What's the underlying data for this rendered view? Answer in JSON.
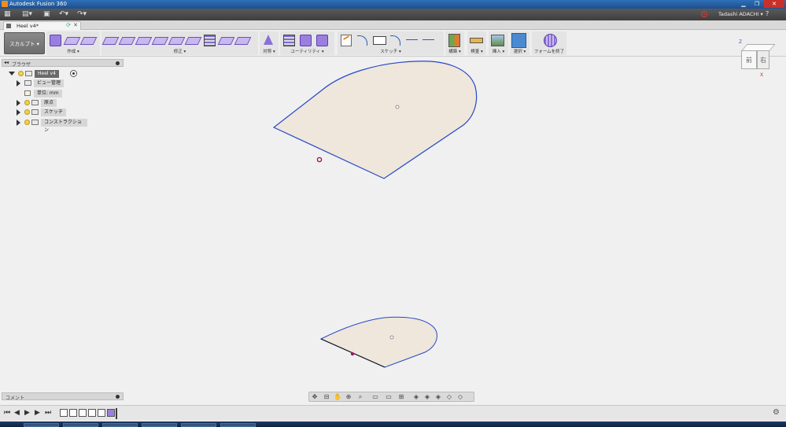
{
  "window": {
    "title": "Autodesk Fusion 360"
  },
  "quickbar": {
    "user": "Tadashi ADACHI ▾",
    "help": "?"
  },
  "tabs": [
    {
      "label": "Heel v4*"
    }
  ],
  "ribbon": {
    "workspace_label": "スカルプト ▾",
    "groups": [
      {
        "id": "create",
        "label": "作成 ▾"
      },
      {
        "id": "modify",
        "label": "修正 ▾"
      },
      {
        "id": "symmetry",
        "label": "対称 ▾"
      },
      {
        "id": "utility",
        "label": "ユーティリティ ▾"
      },
      {
        "id": "sketch",
        "label": "スケッチ ▾"
      },
      {
        "id": "construct",
        "label": "構築 ▾"
      },
      {
        "id": "inspect",
        "label": "検査 ▾"
      },
      {
        "id": "insert",
        "label": "挿入 ▾"
      },
      {
        "id": "select",
        "label": "選択 ▾"
      },
      {
        "id": "finish",
        "label": "フォームを終了"
      }
    ]
  },
  "browser": {
    "title": "ブラウザ",
    "items": [
      {
        "label": "Heel v4"
      },
      {
        "label": "ビュー管理"
      },
      {
        "label": "単位: mm"
      },
      {
        "label": "原点"
      },
      {
        "label": "スケッチ"
      },
      {
        "label": "コンストラクション"
      }
    ]
  },
  "comments": {
    "title": "コメント"
  },
  "viewcube": {
    "front": "前",
    "right": "右",
    "axis_z": "Z",
    "axis_x": "X"
  },
  "colors": {
    "shape_fill": "#efe6dc",
    "shape_outline": "#2448c8",
    "point_marker": "#9b1a6a",
    "title_bar": "#2f6fb6"
  }
}
